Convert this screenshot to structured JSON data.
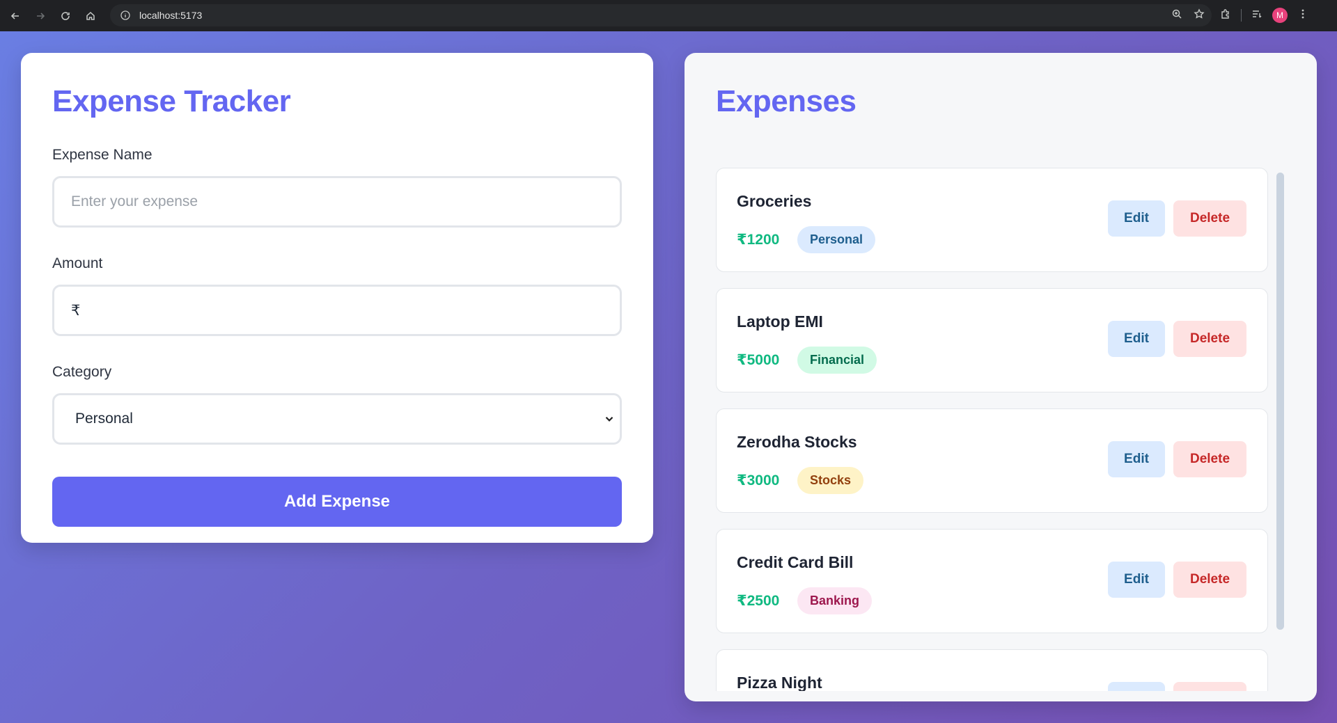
{
  "browser": {
    "url": "localhost:5173",
    "avatar_letter": "M"
  },
  "form": {
    "title": "Expense Tracker",
    "name_label": "Expense Name",
    "name_placeholder": "Enter your expense",
    "amount_label": "Amount",
    "amount_value": "₹",
    "category_label": "Category",
    "category_value": "Personal",
    "submit_label": "Add Expense"
  },
  "list": {
    "title": "Expenses",
    "edit_label": "Edit",
    "delete_label": "Delete",
    "items": [
      {
        "name": "Groceries",
        "amount": "₹1200",
        "category": "Personal"
      },
      {
        "name": "Laptop EMI",
        "amount": "₹5000",
        "category": "Financial"
      },
      {
        "name": "Zerodha Stocks",
        "amount": "₹3000",
        "category": "Stocks"
      },
      {
        "name": "Credit Card Bill",
        "amount": "₹2500",
        "category": "Banking"
      },
      {
        "name": "Pizza Night",
        "amount": "",
        "category": ""
      }
    ]
  },
  "colors": {
    "accent": "#6366f1",
    "amount": "#10b981",
    "badge_personal": "#dbeafe",
    "badge_financial": "#d1fae5",
    "badge_stocks": "#fef3c7",
    "badge_banking": "#fce7f3"
  }
}
